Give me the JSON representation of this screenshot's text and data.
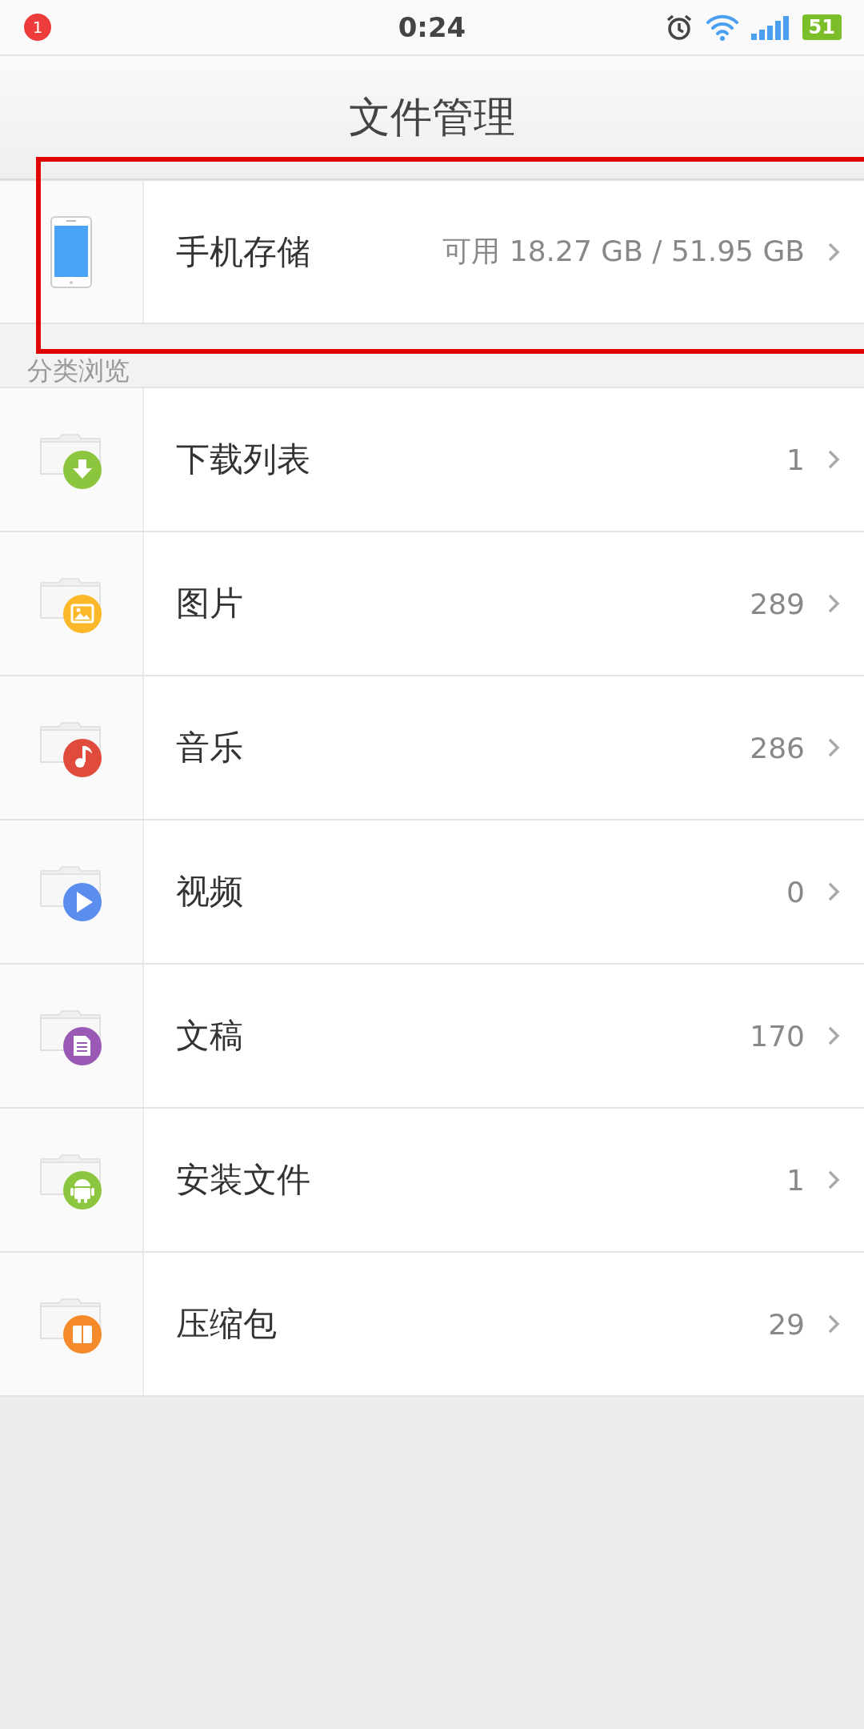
{
  "status_bar": {
    "notification_count": "1",
    "time": "0:24",
    "battery": "51"
  },
  "title": "文件管理",
  "storage": {
    "name": "手机存储",
    "info": "可用 18.27 GB / 51.95 GB"
  },
  "section_label": "分类浏览",
  "categories": [
    {
      "kind": "download",
      "name": "下载列表",
      "count": "1",
      "color": "#8cc63f"
    },
    {
      "kind": "image",
      "name": "图片",
      "count": "289",
      "color": "#fbb829"
    },
    {
      "kind": "music",
      "name": "音乐",
      "count": "286",
      "color": "#e04b3c"
    },
    {
      "kind": "video",
      "name": "视频",
      "count": "0",
      "color": "#5b8def"
    },
    {
      "kind": "document",
      "name": "文稿",
      "count": "170",
      "color": "#9b59b6"
    },
    {
      "kind": "android",
      "name": "安装文件",
      "count": "1",
      "color": "#8cc63f"
    },
    {
      "kind": "archive",
      "name": "压缩包",
      "count": "29",
      "color": "#f58a2a"
    }
  ],
  "highlight": {
    "color": "#e00000"
  }
}
